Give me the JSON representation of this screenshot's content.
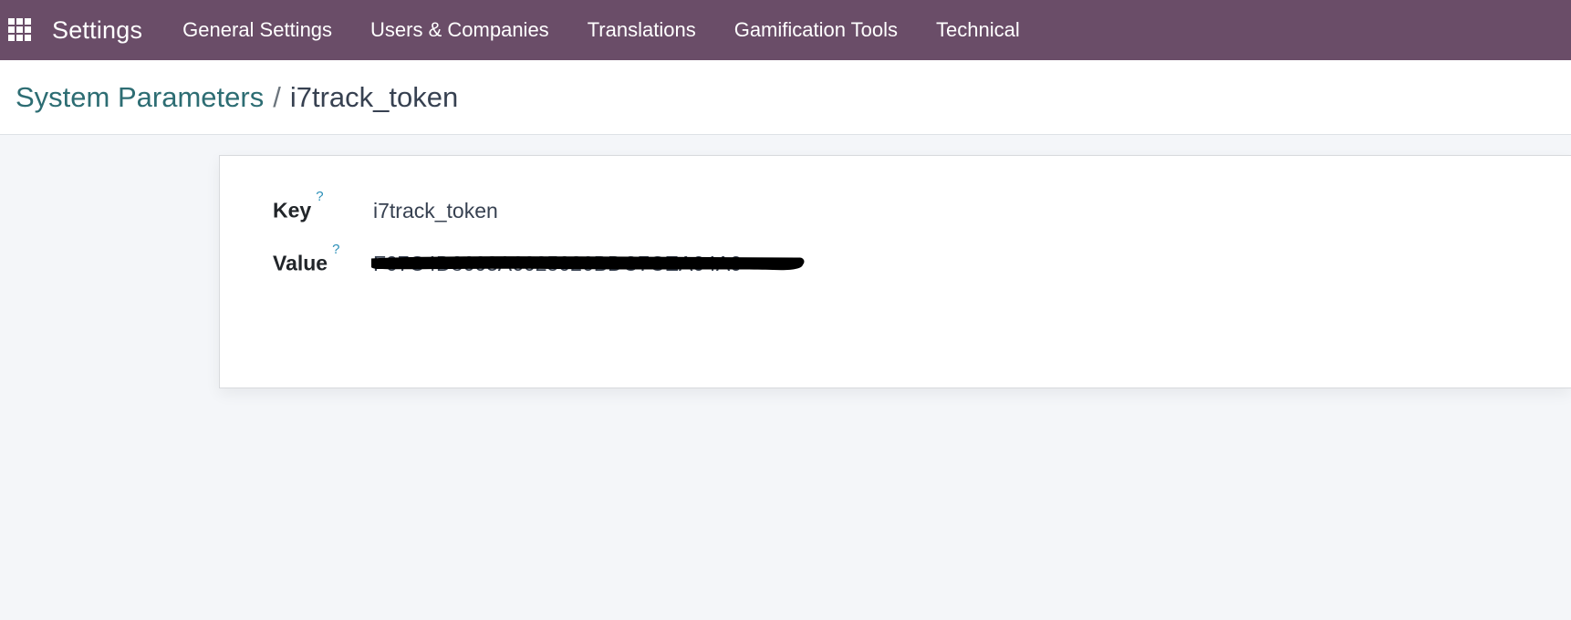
{
  "navbar": {
    "app_name": "Settings",
    "menu": [
      {
        "label": "General Settings"
      },
      {
        "label": "Users & Companies"
      },
      {
        "label": "Translations"
      },
      {
        "label": "Gamification Tools"
      },
      {
        "label": "Technical"
      }
    ]
  },
  "breadcrumb": {
    "parent": "System Parameters",
    "separator": "/",
    "current": "i7track_token"
  },
  "form": {
    "key": {
      "label": "Key",
      "help": "?",
      "value": "i7track_token"
    },
    "value": {
      "label": "Value",
      "help": "?",
      "value": "F07C4D8603A6025026BDC7CEA04A0",
      "redacted": true
    }
  },
  "colors": {
    "navbar_bg": "#6a4d68",
    "breadcrumb_link": "#2d6d73",
    "help_mark": "#2b8fb8",
    "background": "#f4f6f9"
  }
}
